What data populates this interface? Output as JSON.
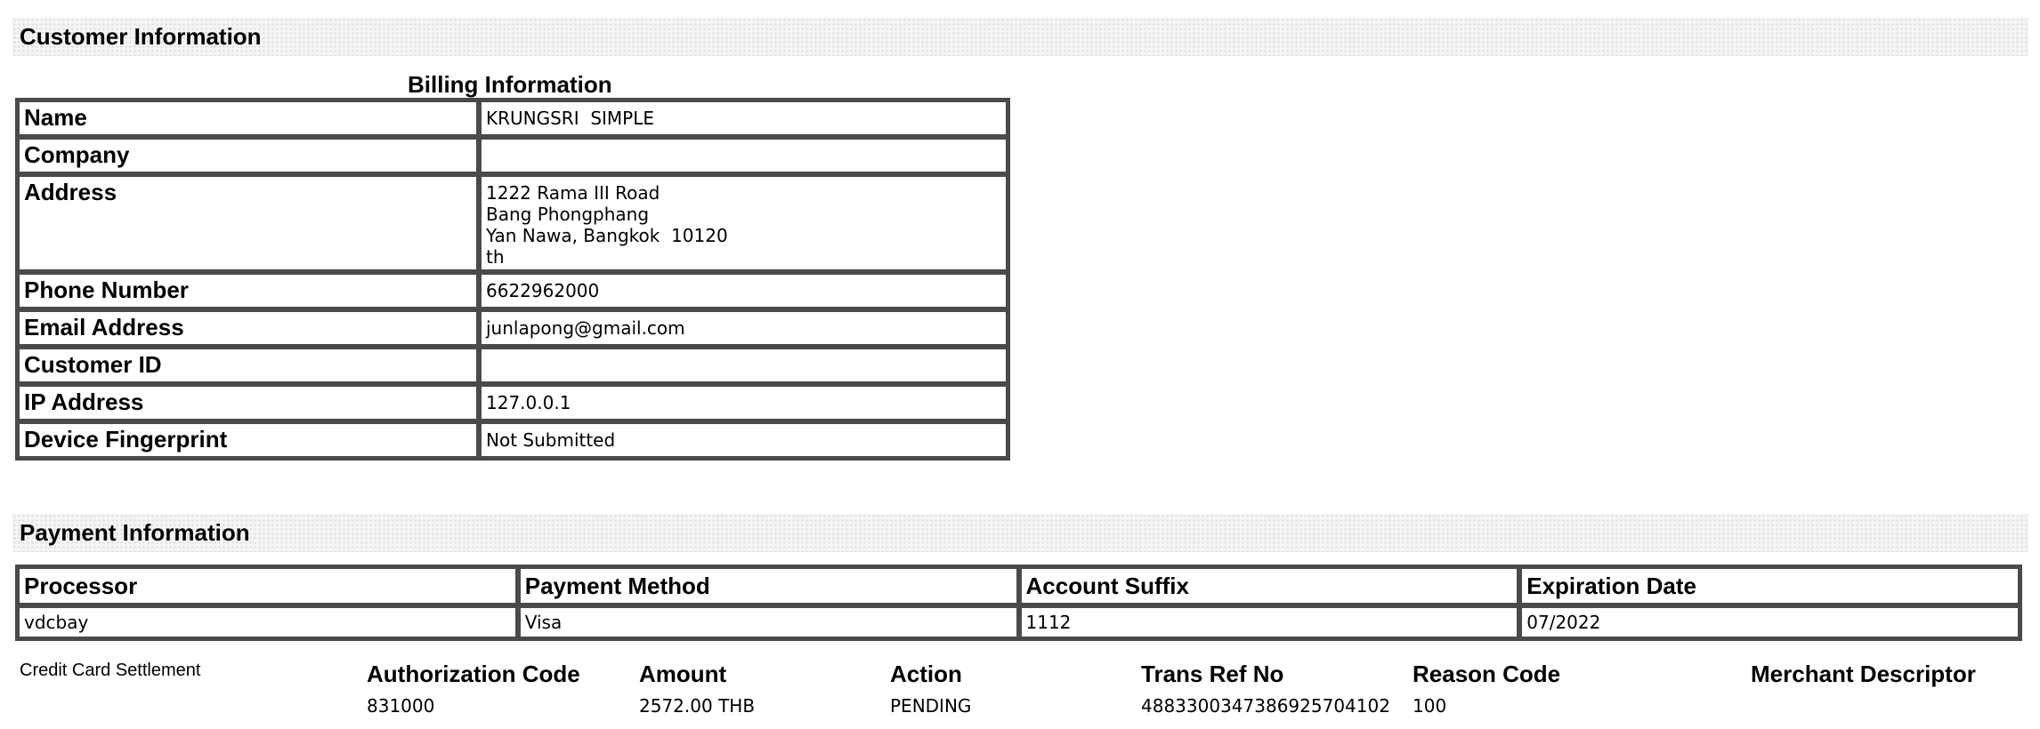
{
  "customer": {
    "section_title": "Customer Information",
    "caption": "Billing Information",
    "rows": [
      {
        "label": "Name",
        "value": "KRUNGSRI  SIMPLE"
      },
      {
        "label": "Company",
        "value": ""
      },
      {
        "label": "Address",
        "lines": [
          "1222 Rama III Road",
          "Bang Phongphang",
          "Yan Nawa, Bangkok  10120",
          "th"
        ]
      },
      {
        "label": "Phone Number",
        "value": "6622962000"
      },
      {
        "label": "Email Address",
        "value": "junlapong@gmail.com"
      },
      {
        "label": "Customer ID",
        "value": ""
      },
      {
        "label": "IP Address",
        "value": "127.0.0.1"
      },
      {
        "label": "Device Fingerprint",
        "value": "Not Submitted"
      }
    ]
  },
  "payment": {
    "section_title": "Payment Information",
    "headers": [
      "Processor",
      "Payment Method",
      "Account Suffix",
      "Expiration Date"
    ],
    "values": [
      "vdcbay",
      "Visa",
      "1112",
      "07/2022"
    ]
  },
  "transaction": {
    "label": "Credit Card Settlement",
    "columns": [
      {
        "header": "Authorization Code",
        "value": "831000"
      },
      {
        "header": "Amount",
        "value": "2572.00 THB"
      },
      {
        "header": "Action",
        "value": "PENDING"
      },
      {
        "header": "Trans Ref No",
        "value": "4883300347386925704102"
      },
      {
        "header": "Reason Code",
        "value": "100"
      },
      {
        "header": "Merchant Descriptor",
        "value": ""
      }
    ]
  }
}
